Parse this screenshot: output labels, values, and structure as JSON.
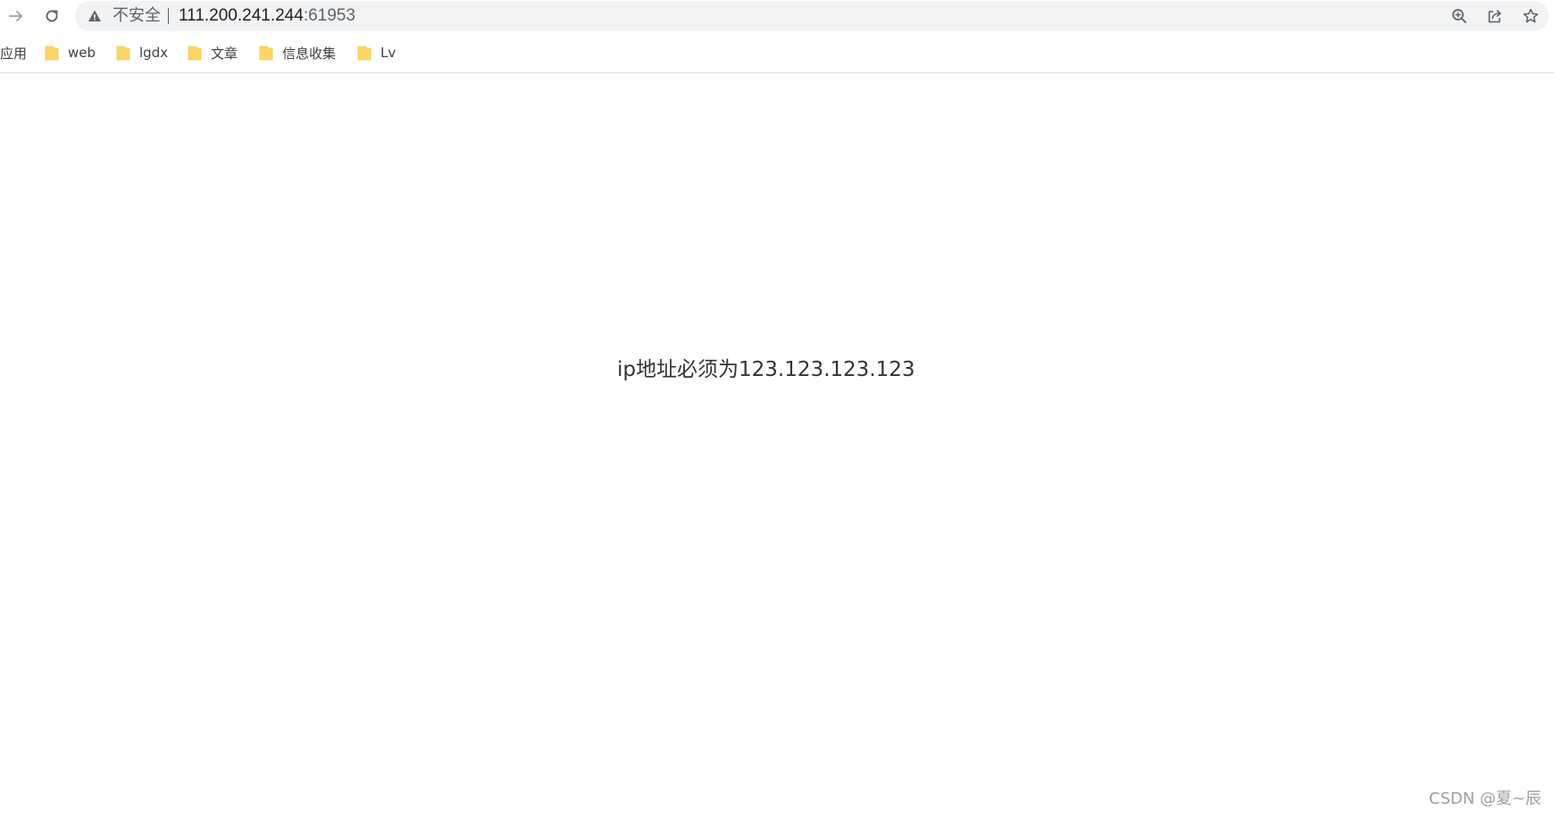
{
  "toolbar": {
    "forward_icon": "arrow-right-icon",
    "reload_icon": "reload-icon",
    "security_label": "不安全",
    "url_host": "111.200.241.244",
    "url_port": ":61953",
    "zoom_icon": "zoom-in-icon",
    "share_icon": "share-icon",
    "bookmark_icon": "star-icon"
  },
  "bookmarks": {
    "apps_label": "应用",
    "items": [
      {
        "label": "web"
      },
      {
        "label": "lgdx"
      },
      {
        "label": "文章"
      },
      {
        "label": "信息收集"
      },
      {
        "label": "Lv"
      }
    ]
  },
  "page": {
    "message": "ip地址必须为123.123.123.123"
  },
  "watermark": "CSDN @夏~辰",
  "colors": {
    "omnibox_bg": "#f1f3f4",
    "folder": "#fdd663",
    "text": "#333333"
  }
}
